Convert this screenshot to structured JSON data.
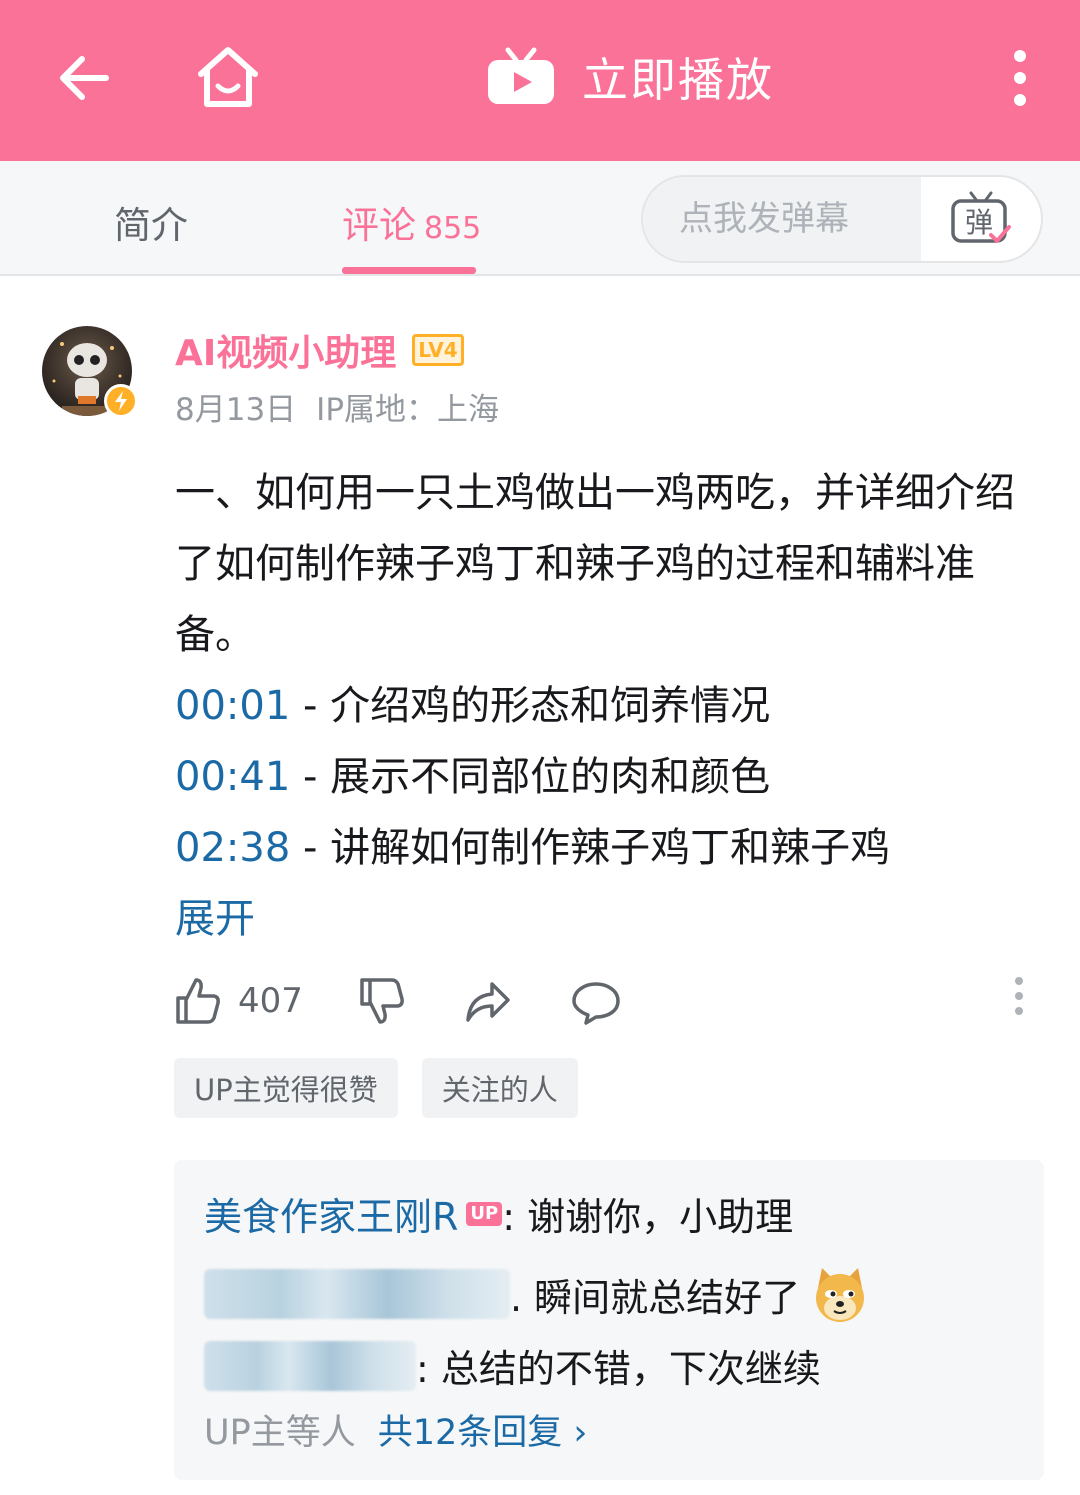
{
  "topbar": {
    "title": "立即播放",
    "accent": "#fb7299",
    "icons": [
      "back-arrow-icon",
      "home-icon",
      "tv-play-icon",
      "more-vertical-icon"
    ]
  },
  "tabs": {
    "intro_label": "简介",
    "comments_label": "评论",
    "comments_count": "855",
    "danmaku_placeholder": "点我发弹幕",
    "danmaku_toggle_label": "弹"
  },
  "comment": {
    "username": "AI视频小助理",
    "level": "LV4",
    "date": "8月13日",
    "ip_location": "IP属地：上海",
    "intro_text": "一、如何用一只土鸡做出一鸡两吃，并详细介绍了如何制作辣子鸡丁和辣子鸡的过程和辅料准备。",
    "timestamps": [
      {
        "time": "00:01",
        "text": " - 介绍鸡的形态和饲养情况"
      },
      {
        "time": "00:41",
        "text": " - 展示不同部位的肉和颜色"
      },
      {
        "time": "02:38",
        "text": " - 讲解如何制作辣子鸡丁和辣子鸡"
      }
    ],
    "expand_label": "展开",
    "like_count": "407",
    "tags": [
      "UP主觉得很赞",
      "关注的人"
    ]
  },
  "replies": {
    "items": [
      {
        "name": "美食作家王刚R",
        "badge": "UP",
        "text": ": 谢谢你，小助理"
      },
      {
        "text": ". 瞬间就总结好了"
      },
      {
        "text": ": 总结的不错，下次继续"
      }
    ],
    "footer_who": "UP主等人",
    "footer_total": "共12条回复 ›"
  }
}
